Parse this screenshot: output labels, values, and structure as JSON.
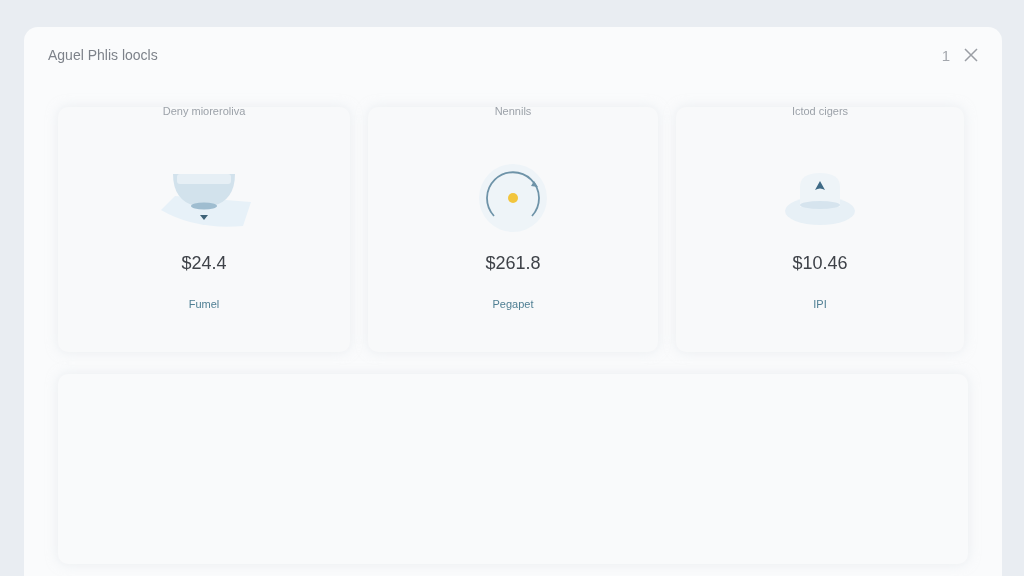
{
  "dialog": {
    "title": "Aguel Phlis loocls",
    "counter": "1"
  },
  "cards": [
    {
      "caption": "Deny mioreroliva",
      "kind": "bowl",
      "price": "$24.4",
      "label": "Fumel"
    },
    {
      "caption": "Nennils",
      "kind": "dial",
      "price": "$261.8",
      "label": "Pegapet"
    },
    {
      "caption": "Ictod cigers",
      "kind": "hat",
      "price": "$10.46",
      "label": "IPI"
    }
  ]
}
